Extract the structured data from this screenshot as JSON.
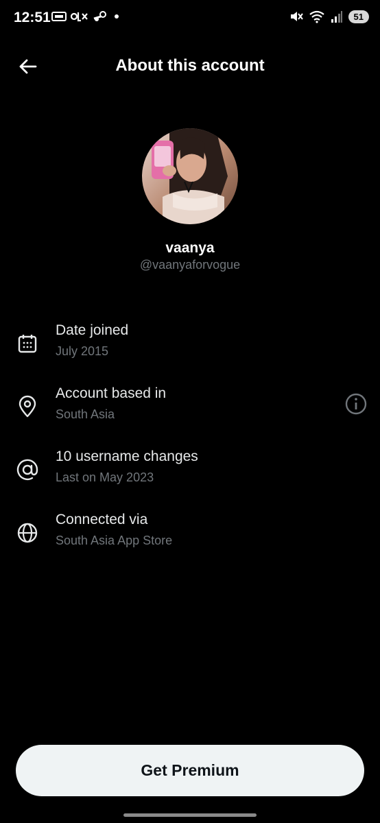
{
  "status_bar": {
    "time": "12:51",
    "battery": "51",
    "left_icons": [
      "cricbuzz-icon",
      "olx-icon",
      "steam-icon",
      "dot-icon"
    ],
    "right_icons": [
      "mute-icon",
      "wifi-icon",
      "signal-icon",
      "battery-icon"
    ]
  },
  "header": {
    "title": "About this account",
    "back_icon": "arrow-left-icon"
  },
  "profile": {
    "display_name": "vaanya",
    "handle": "@vaanyaforvogue"
  },
  "info_rows": [
    {
      "icon": "calendar-icon",
      "title": "Date joined",
      "subtitle": "July 2015"
    },
    {
      "icon": "location-pin-icon",
      "title": "Account based in",
      "subtitle": "South Asia"
    },
    {
      "icon": "at-sign-icon",
      "title": "10 username changes",
      "subtitle": "Last on May 2023"
    },
    {
      "icon": "globe-icon",
      "title": "Connected via",
      "subtitle": "South Asia App Store"
    }
  ],
  "premium_button_label": "Get Premium",
  "colors": {
    "background": "#000000",
    "primary_text": "#e7e9ea",
    "secondary_text": "#71767b",
    "button_background": "#eff3f4"
  }
}
